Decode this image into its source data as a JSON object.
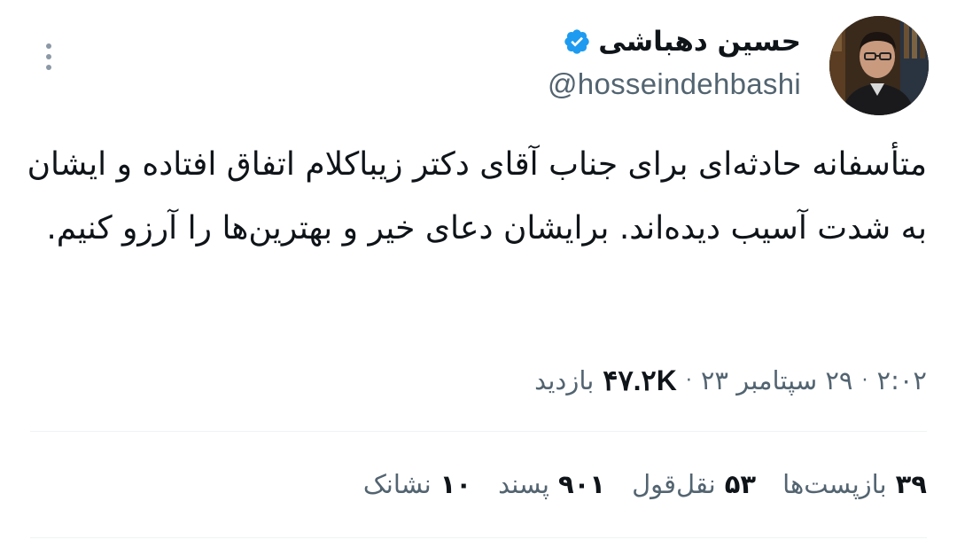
{
  "author": {
    "display_name": "حسین دهباشی",
    "handle": "@hosseindehbashi",
    "verified": true,
    "avatar_icon": "profile-photo"
  },
  "tweet": {
    "text": "متأسفانه حادثه‌ای برای جناب آقای دکتر زیباکلام اتفاق افتاده و ایشان به شدت آسیب دیده‌اند. برایشان دعای خیر و بهترین‌ها را آرزو کنیم."
  },
  "meta": {
    "time": "۲:۰۲",
    "separator": "·",
    "date": "۲۹ سپتامبر ۲۳",
    "views_count": "۴۷.۲K",
    "views_label": "بازدید"
  },
  "stats": [
    {
      "count": "۳۹",
      "label": "بازپست‌ها"
    },
    {
      "count": "۵۳",
      "label": "نقل‌قول"
    },
    {
      "count": "۹۰۱",
      "label": "پسند"
    },
    {
      "count": "۱۰",
      "label": "نشانک"
    }
  ],
  "colors": {
    "text_primary": "#0f1419",
    "text_secondary": "#536471",
    "verified_blue": "#1d9bf0",
    "divider": "#eff3f4"
  }
}
